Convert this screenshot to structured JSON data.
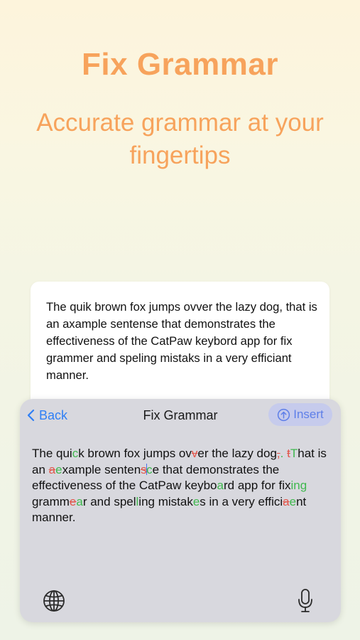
{
  "hero": {
    "title": "Fix Grammar",
    "subtitle": "Accurate grammar at your fingertips"
  },
  "note": {
    "text": "The quik brown fox jumps ovver the lazy dog, that is an axample sentense that demonstrates the effectiveness of the CatPaw keybord app for fix grammer and speling mistaks in a very efficiant manner."
  },
  "keyboard": {
    "back_label": "Back",
    "title": "Fix Grammar",
    "insert_label": "Insert",
    "icons": {
      "back": "chevron-left-icon",
      "insert": "arrow-up-circle-icon",
      "globe": "globe-icon",
      "mic": "microphone-icon"
    },
    "colors": {
      "accent": "#2f7ff5",
      "insert_bg": "#c6cbec",
      "insert_fg": "#5e7fe8",
      "added": "#3fb84e",
      "removed": "#e2564b",
      "headline": "#f7a35c"
    }
  },
  "corrected": {
    "segments": [
      {
        "t": "The qui"
      },
      {
        "t": "c",
        "op": "add"
      },
      {
        "t": "k brown fox jumps ov"
      },
      {
        "t": "v",
        "op": "del"
      },
      {
        "t": "er the lazy dog"
      },
      {
        "t": ",",
        "op": "del"
      },
      {
        "t": ".",
        "op": "add"
      },
      {
        "t": " "
      },
      {
        "t": "t",
        "op": "del"
      },
      {
        "t": "T",
        "op": "add"
      },
      {
        "t": "hat is an "
      },
      {
        "t": "a",
        "op": "del"
      },
      {
        "t": "e",
        "op": "add"
      },
      {
        "t": "xample senten"
      },
      {
        "t": "s",
        "op": "del"
      },
      {
        "t": "c",
        "op": "add"
      },
      {
        "t": "e that demonstrates the effectiveness of the CatPaw keybo"
      },
      {
        "t": "a",
        "op": "add"
      },
      {
        "t": "rd app for fix"
      },
      {
        "t": "ing",
        "op": "add"
      },
      {
        "t": " gramm"
      },
      {
        "t": "e",
        "op": "del"
      },
      {
        "t": "a",
        "op": "add"
      },
      {
        "t": "r and spel"
      },
      {
        "t": "l",
        "op": "add"
      },
      {
        "t": "ing mistak"
      },
      {
        "t": "e",
        "op": "add"
      },
      {
        "t": "s in a very effici"
      },
      {
        "t": "a",
        "op": "del"
      },
      {
        "t": "e",
        "op": "add"
      },
      {
        "t": "nt manner."
      }
    ]
  }
}
